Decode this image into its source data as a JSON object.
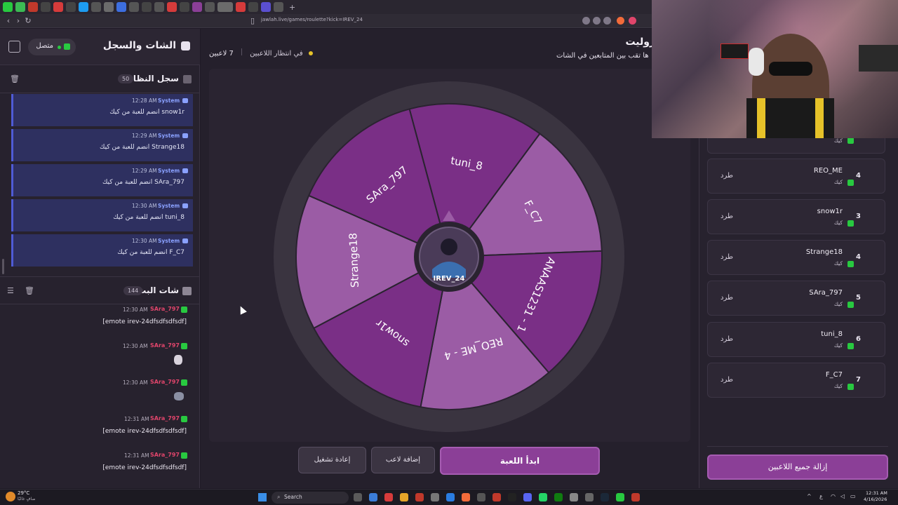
{
  "browser": {
    "url": "jawlah.live/games/roulette?kick=IREV_24"
  },
  "left_panel": {
    "title": "الشات والسجل",
    "status_label": "متصل",
    "system_log": {
      "title": "سجل النظام",
      "count": "50",
      "messages": [
        {
          "time": "12:28 AM",
          "sender": "System",
          "text": "snow1r انضم للعبة من كيك"
        },
        {
          "time": "12:29 AM",
          "sender": "System",
          "text": "Strange18 انضم للعبة من كيك"
        },
        {
          "time": "12:29 AM",
          "sender": "System",
          "text": "SAra_797 انضم للعبة من كيك"
        },
        {
          "time": "12:30 AM",
          "sender": "System",
          "text": "tuni_8 انضم للعبة من كيك"
        },
        {
          "time": "12:30 AM",
          "sender": "System",
          "text": "F_C7 انضم للعبة من كيك"
        }
      ]
    },
    "stream_chat": {
      "title": "شات البث",
      "count": "144",
      "messages": [
        {
          "time": "12:30 AM",
          "user": "SAra_797",
          "text": "[emote irev-24dfsdfsdfsdf]"
        },
        {
          "time": "12:30 AM",
          "user": "SAra_797",
          "text": ""
        },
        {
          "time": "12:30 AM",
          "user": "SAra_797",
          "text": ""
        },
        {
          "time": "12:31 AM",
          "user": "SAra_797",
          "text": "[emote irev-24dfsdfsdfsdf]"
        },
        {
          "time": "12:31 AM",
          "user": "SAra_797",
          "text": "[emote irev-24dfsdfsdfsdf]"
        }
      ]
    }
  },
  "center": {
    "title": "روليت",
    "subtitle": "ها تقب بين المتابعين في الشات",
    "players_count": "7 لاعبين",
    "waiting_label": "في انتظار اللاعبين",
    "wheel": {
      "center_label": "IREV_24",
      "segments": [
        "tuni_8",
        "F_C7",
        "ANAAS1231 - 1",
        "REO_ME - 4",
        "snow1r",
        "Strange18",
        "SAra_797"
      ]
    },
    "buttons": {
      "start": "ابدأ اللعبة",
      "add_player": "إضافة لاعب",
      "restart": "إعادة تشغيل"
    }
  },
  "right_panel": {
    "players": [
      {
        "num": "4",
        "name": "REO_ME",
        "platform": "كيك",
        "kick_label": "طرد"
      },
      {
        "num": "3",
        "name": "snow1r",
        "platform": "كيك",
        "kick_label": "طرد"
      },
      {
        "num": "4",
        "name": "Strange18",
        "platform": "كيك",
        "kick_label": "طرد"
      },
      {
        "num": "5",
        "name": "SAra_797",
        "platform": "كيك",
        "kick_label": "طرد"
      },
      {
        "num": "6",
        "name": "tuni_8",
        "platform": "كيك",
        "kick_label": "طرد"
      },
      {
        "num": "7",
        "name": "F_C7",
        "platform": "كيك",
        "kick_label": "طرد"
      }
    ],
    "partial_platform": "كيك",
    "remove_all": "إزالة جميع اللاعبين"
  },
  "taskbar": {
    "search": "Search",
    "weather_temp": "29°C",
    "weather_desc": "صافٍ غالبًا",
    "time": "12:31 AM",
    "date": "4/16/2026",
    "lang": "ع"
  },
  "colors": {
    "accent": "#8b3f97",
    "segment_dark": "#7a2f86",
    "segment_light": "#9b5ca5",
    "kick_green": "#28c940"
  }
}
